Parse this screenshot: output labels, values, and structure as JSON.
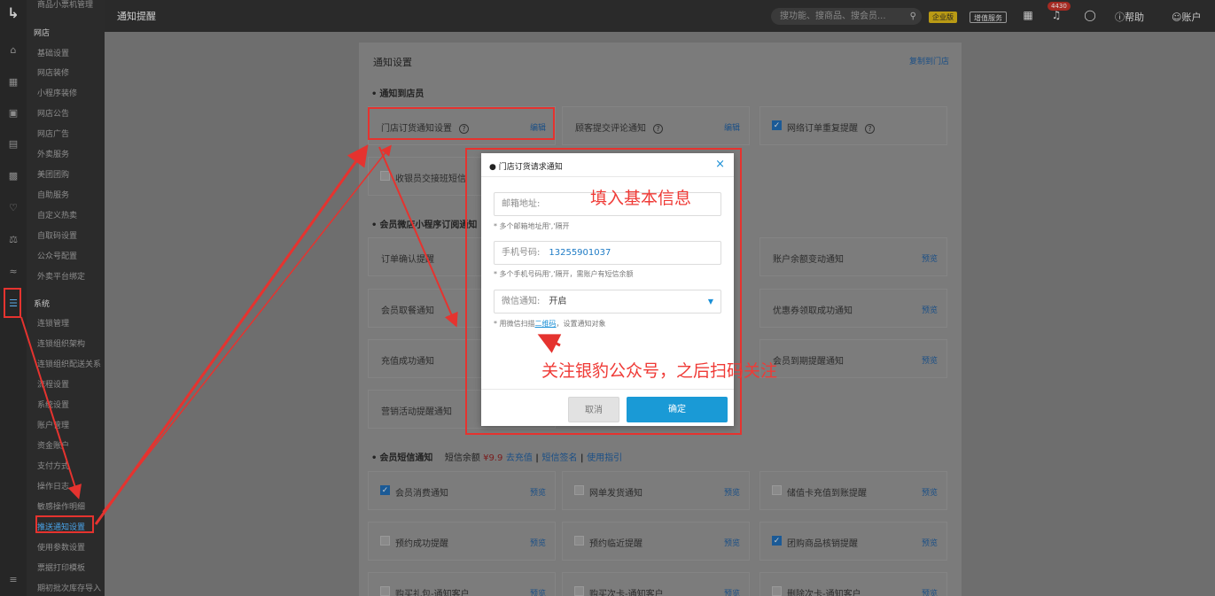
{
  "menu": {
    "top_item": "商品小票机管理",
    "groups": [
      {
        "title": "网店",
        "items": [
          "基础设置",
          "网店装修",
          "小程序装修",
          "网店公告",
          "网店广告",
          "外卖服务",
          "美团团购",
          "自助服务",
          "自定义热卖",
          "自取码设置",
          "公众号配置",
          "外卖平台绑定"
        ]
      },
      {
        "title": "系统",
        "items": [
          "连锁管理",
          "连锁组织架构",
          "连锁组织配送关系",
          "流程设置",
          "系统设置",
          "账户管理",
          "资金账户",
          "支付方式",
          "操作日志",
          "敏感操作明细",
          "推送通知设置",
          "使用参数设置",
          "票据打印模板",
          "期初批次库存导入"
        ]
      }
    ],
    "active_item": "推送通知设置"
  },
  "topbar": {
    "page_title": "通知提醒",
    "search_placeholder": "搜功能、搜商品、搜会员...",
    "badge_enterprise": "企业版",
    "badge_addon": "增值服务",
    "msg_count": "4430",
    "help": "帮助",
    "account": "账户"
  },
  "panel": {
    "title": "通知设置",
    "copy_link": "复制到门店",
    "sec_store": "通知到店员",
    "sec_wechat": "会员微店小程序订阅通知",
    "sec_sms": "会员短信通知",
    "sms_balance_label": "短信余额",
    "sms_balance": "¥9.9",
    "sms_recharge": "去充值",
    "sms_sign": "短信签名",
    "sms_guide": "使用指引",
    "edit": "编辑",
    "preview": "预览",
    "store_cards": [
      "门店订货通知设置",
      "顾客提交评论通知",
      "网络订单重复提醒",
      "收银员交接班短信"
    ],
    "wechat_left": [
      "订单确认提醒",
      "会员取餐通知",
      "充值成功通知",
      "营销活动提醒通知"
    ],
    "wechat_right": [
      "账户余额变动通知",
      "优惠券领取成功通知",
      "会员到期提醒通知"
    ],
    "sms_row1": [
      "会员消费通知",
      "网单发货通知",
      "储值卡充值到账提醒"
    ],
    "sms_row2": [
      "预约成功提醒",
      "预约临近提醒",
      "团购商品核销提醒"
    ],
    "sms_row3": [
      "购买礼包-通知客户",
      "购买次卡-通知客户",
      "删除次卡-通知客户"
    ]
  },
  "modal": {
    "title": "门店订货请求通知",
    "email_label": "邮箱地址:",
    "email_hint": "* 多个邮箱地址用','隔开",
    "phone_label": "手机号码:",
    "phone_value": "13255901037",
    "phone_hint": "* 多个手机号码用','隔开，需账户有短信余额",
    "wechat_label": "微信通知:",
    "wechat_value": "开启",
    "wechat_hint_pre": "* 用微信扫描",
    "wechat_hint_link": "二维码",
    "wechat_hint_post": "，设置通知对象",
    "cancel": "取消",
    "confirm": "确定"
  },
  "annotations": {
    "note1": "填入基本信息",
    "note2": "关注银豹公众号，之后扫码关注",
    "color": "#e5332f"
  }
}
